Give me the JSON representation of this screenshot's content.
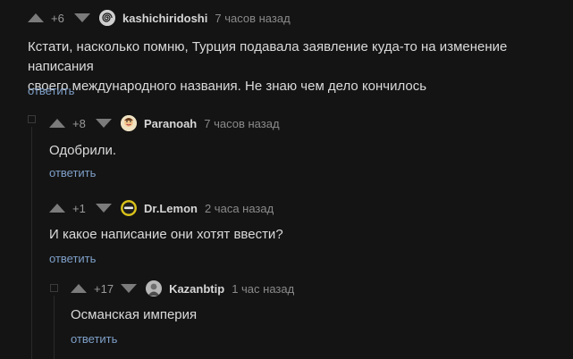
{
  "comments": [
    {
      "rating": "+6",
      "author": "kashichiridoshi",
      "time": "7 часов назад",
      "text_lines": [
        "Кстати, насколько помню, Турция подавала заявление куда-то на изменение написания",
        "своего международного названия. Не знаю чем дело кончилось"
      ],
      "reply_label": "ответить",
      "avatar_icon": "avatar-spiral-icon"
    },
    {
      "rating": "+8",
      "author": "Paranoah",
      "time": "7 часов назад",
      "text_lines": [
        "Одобрили."
      ],
      "reply_label": "ответить",
      "avatar_icon": "avatar-face-icon"
    },
    {
      "rating": "+1",
      "author": "Dr.Lemon",
      "time": "2 часа назад",
      "text_lines": [
        "И какое написание они хотят ввести?"
      ],
      "reply_label": "ответить",
      "avatar_icon": "avatar-lemon-icon"
    },
    {
      "rating": "+17",
      "author": "Kazanbtip",
      "time": "1 час назад",
      "text_lines": [
        "Османская империя"
      ],
      "reply_label": "ответить",
      "avatar_icon": "avatar-photo-icon"
    }
  ],
  "colors": {
    "background": "#141414",
    "reply_link": "#7fa0c9",
    "vote_arrow": "#7b7b7b"
  }
}
